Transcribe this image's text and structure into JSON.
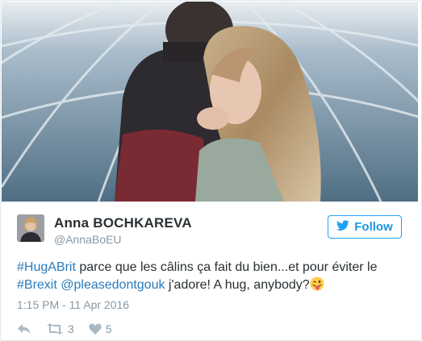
{
  "tweet": {
    "author_name": "Anna BOCHKAREVA",
    "author_handle": "@AnnaBoEU",
    "follow_label": "Follow",
    "text_segments": [
      {
        "type": "hashtag",
        "text": "#HugABrit"
      },
      {
        "type": "text",
        "text": " parce que les câlins ça fait du bien...et pour éviter le "
      },
      {
        "type": "hashtag",
        "text": "#Brexit"
      },
      {
        "type": "text",
        "text": " "
      },
      {
        "type": "mention",
        "text": "@pleasedontgouk"
      },
      {
        "type": "text",
        "text": " j'adore! A hug, anybody?"
      }
    ],
    "timestamp": "1:15 PM - 11 Apr 2016",
    "retweet_count": "3",
    "like_count": "5"
  },
  "icons": {
    "follow": "twitter-bird-icon",
    "reply": "reply-icon",
    "retweet": "retweet-icon",
    "like": "heart-icon",
    "emoji": "winking-tongue-emoji"
  },
  "colors": {
    "link": "#2b7bb9",
    "follow_accent": "#1b95e0",
    "muted": "#8899a6",
    "text": "#292f33"
  }
}
